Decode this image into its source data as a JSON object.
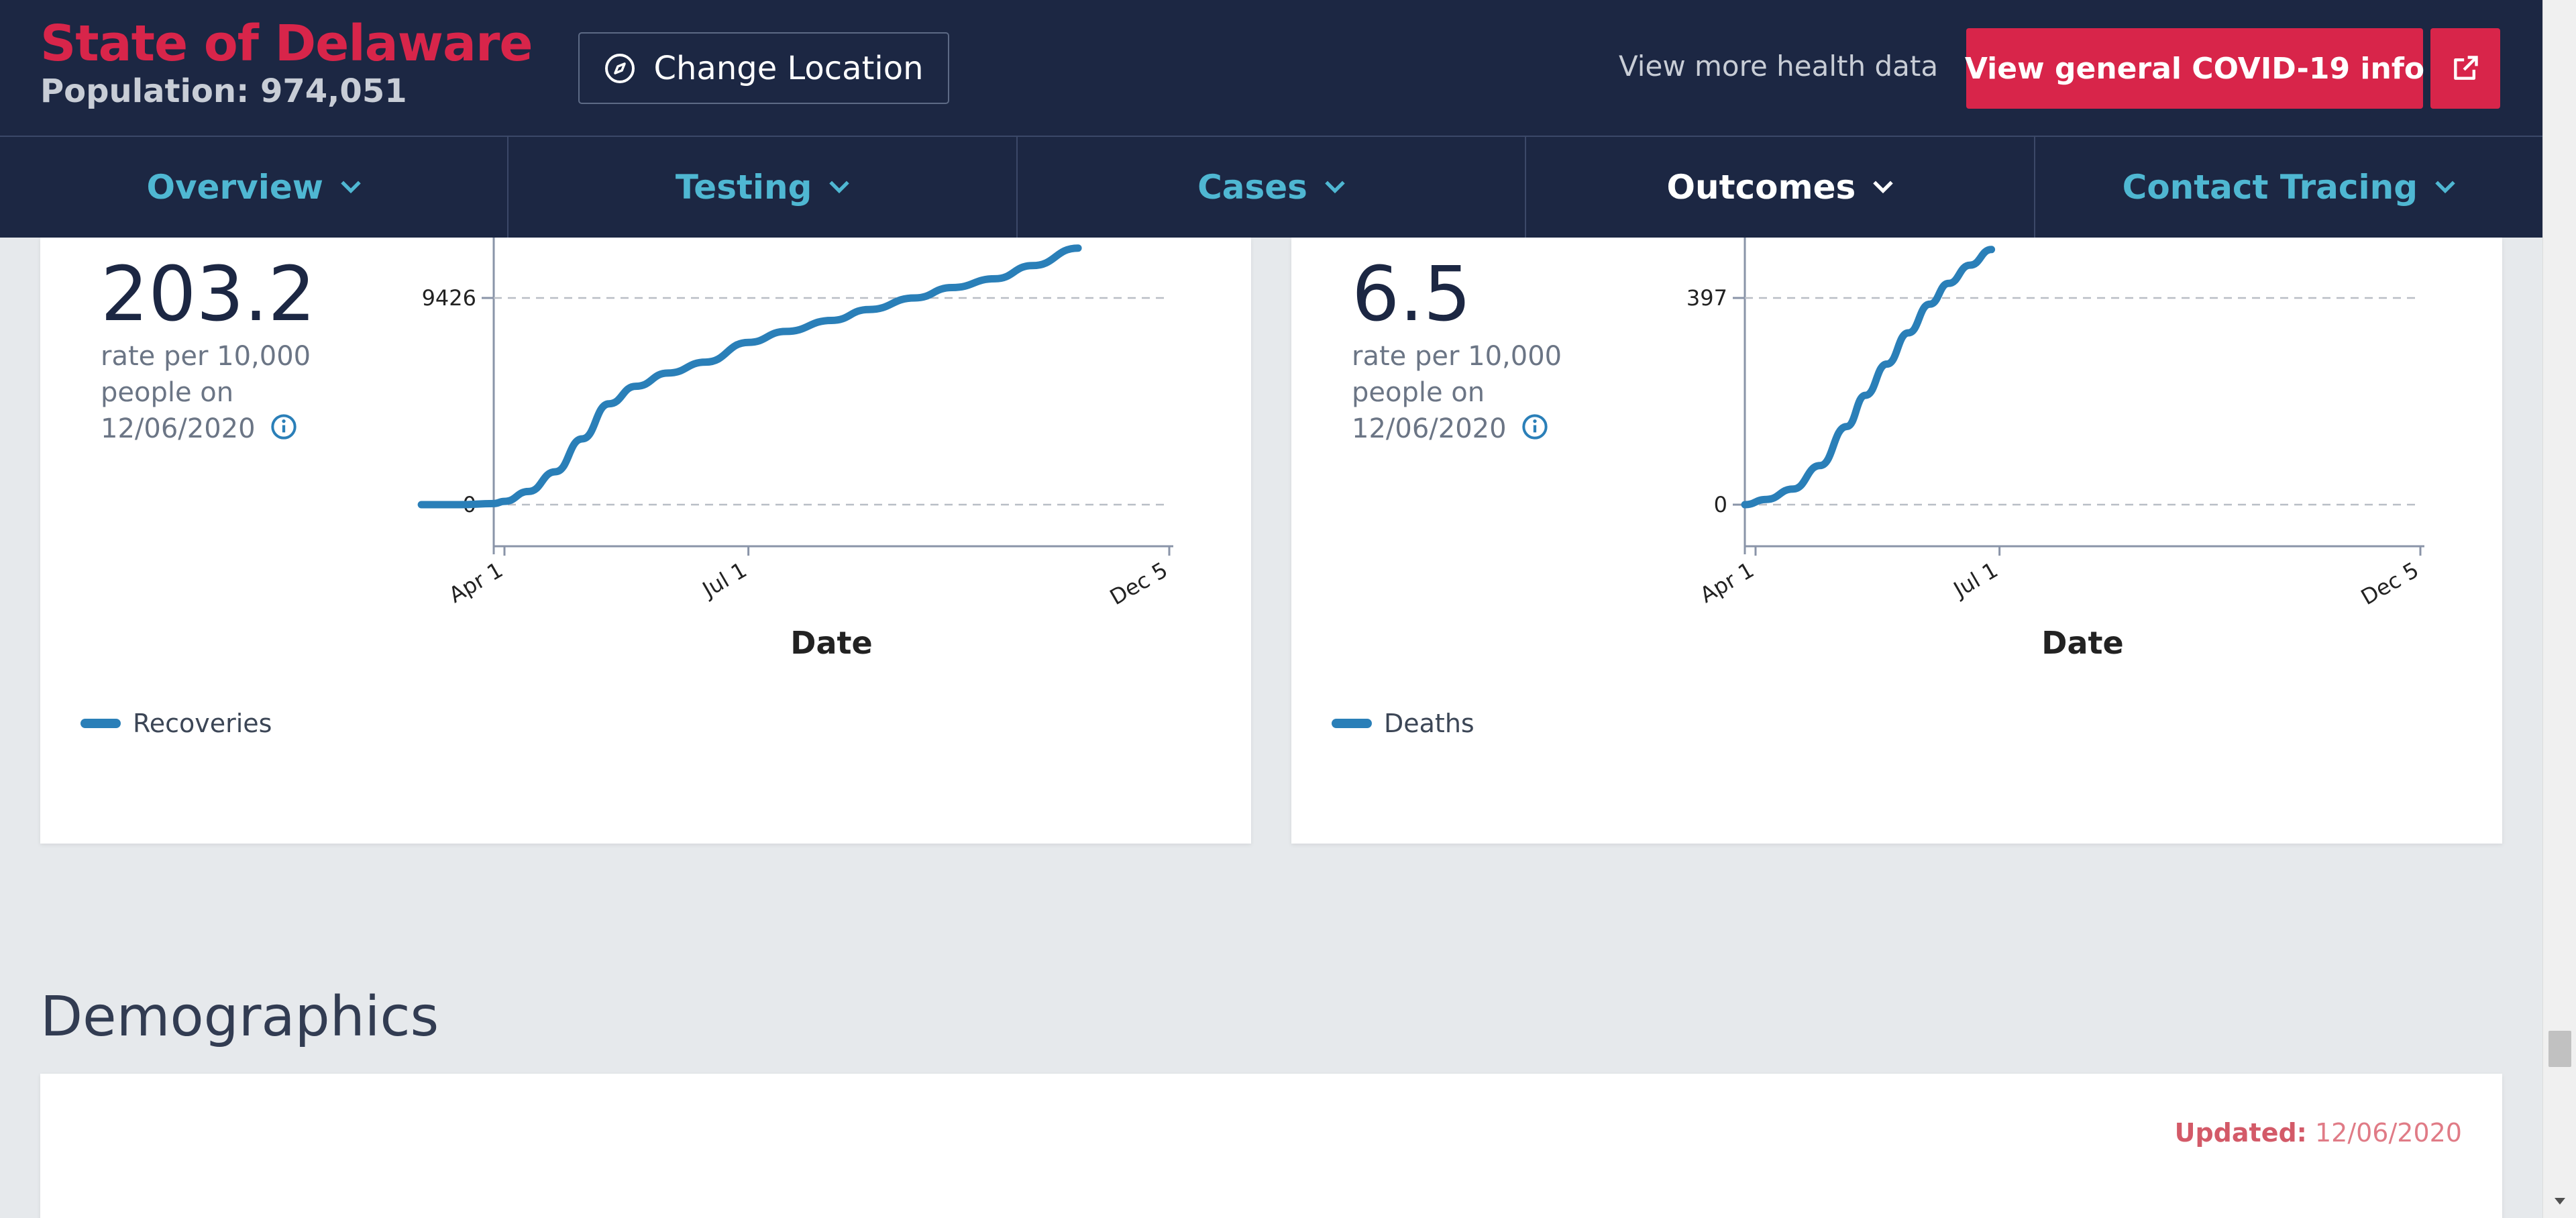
{
  "header": {
    "state_title": "State of Delaware",
    "population": "Population: 974,051",
    "change_location_label": "Change Location",
    "more_health_label": "View more health data",
    "covid_info_label": "View general COVID-19 info"
  },
  "nav": {
    "items": [
      {
        "label": "Overview",
        "active": false
      },
      {
        "label": "Testing",
        "active": false
      },
      {
        "label": "Cases",
        "active": false
      },
      {
        "label": "Outcomes",
        "active": true
      },
      {
        "label": "Contact Tracing",
        "active": false
      }
    ]
  },
  "cards": [
    {
      "value": "203.2",
      "desc_line1": "rate per 10,000",
      "desc_line2": "people on",
      "desc_date": "12/06/2020",
      "legend": "Recoveries"
    },
    {
      "value": "6.5",
      "desc_line1": "rate per 10,000",
      "desc_line2": "people on",
      "desc_date": "12/06/2020",
      "legend": "Deaths"
    }
  ],
  "chart_data": [
    {
      "type": "line",
      "xlabel": "Date",
      "x_ticks": [
        "Apr 1",
        "Jul 1",
        "Dec 5"
      ],
      "y_ticks": [
        0,
        9426
      ],
      "grid": true,
      "series": [
        {
          "name": "Recoveries",
          "color": "#2a7fb8",
          "points": [
            [
              "Mar 1",
              0
            ],
            [
              "Mar 15",
              0
            ],
            [
              "Mar 28",
              50
            ],
            [
              "Apr 1",
              150
            ],
            [
              "Apr 10",
              600
            ],
            [
              "Apr 20",
              1500
            ],
            [
              "Apr 30",
              3000
            ],
            [
              "May 10",
              4600
            ],
            [
              "May 20",
              5400
            ],
            [
              "Jun 1",
              6000
            ],
            [
              "Jun 15",
              6500
            ],
            [
              "Jul 1",
              7400
            ],
            [
              "Jul 15",
              7900
            ],
            [
              "Aug 1",
              8400
            ],
            [
              "Aug 15",
              8900
            ],
            [
              "Sep 1",
              9426
            ],
            [
              "Sep 15",
              9900
            ],
            [
              "Oct 1",
              10300
            ],
            [
              "Oct 15",
              10900
            ],
            [
              "Nov 1",
              11700
            ]
          ]
        }
      ]
    },
    {
      "type": "line",
      "xlabel": "Date",
      "x_ticks": [
        "Apr 1",
        "Jul 1",
        "Dec 5"
      ],
      "y_ticks": [
        0,
        397
      ],
      "grid": true,
      "series": [
        {
          "name": "Deaths",
          "color": "#2a7fb8",
          "points": [
            [
              "Mar 28",
              0
            ],
            [
              "Apr 5",
              10
            ],
            [
              "Apr 15",
              30
            ],
            [
              "Apr 25",
              75
            ],
            [
              "May 5",
              150
            ],
            [
              "May 12",
              210
            ],
            [
              "May 20",
              270
            ],
            [
              "May 28",
              330
            ],
            [
              "Jun 5",
              385
            ],
            [
              "Jun 12",
              425
            ],
            [
              "Jun 20",
              460
            ],
            [
              "Jun 28",
              490
            ]
          ]
        }
      ]
    }
  ],
  "demographics": {
    "title": "Demographics",
    "updated_label": "Updated:",
    "updated_value": "12/06/2020"
  }
}
